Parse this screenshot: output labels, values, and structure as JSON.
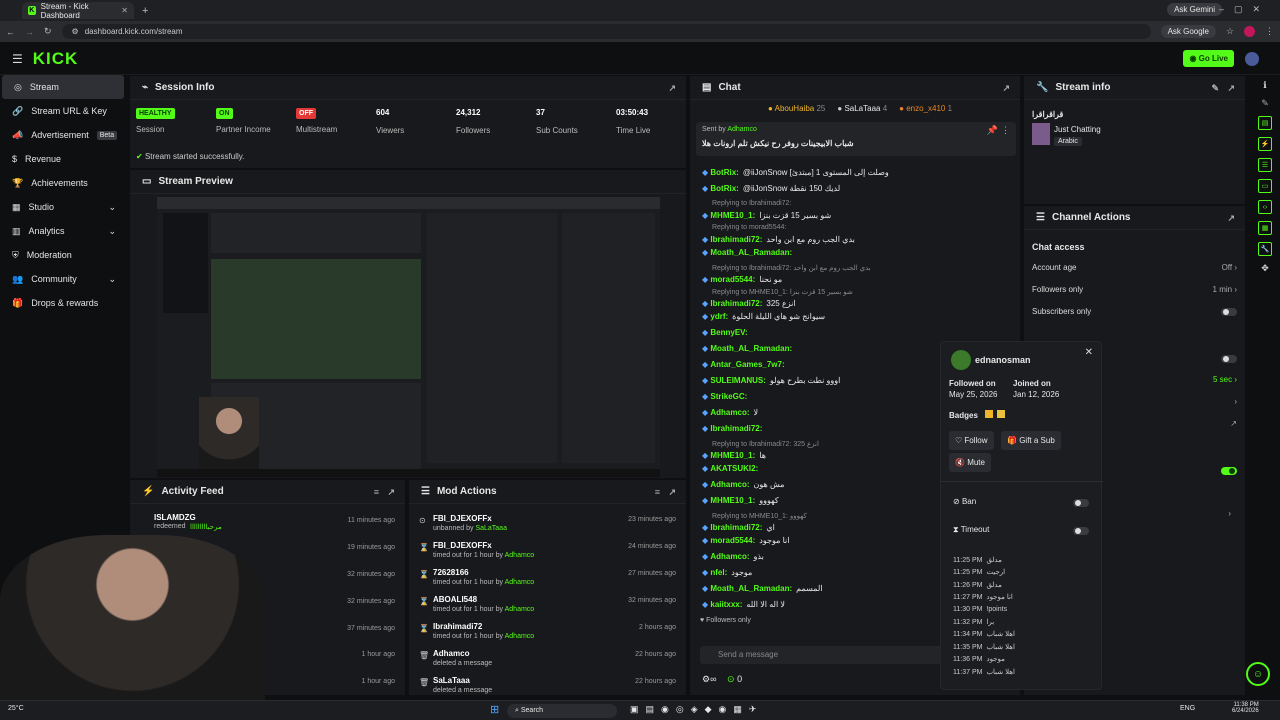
{
  "browser": {
    "tab_title": "Stream - Kick Dashboard",
    "url": "dashboard.kick.com/stream",
    "ask_gemini": "Ask Gemini",
    "ask_google": "Ask Google"
  },
  "app": {
    "logo": "KICK",
    "go_live": "Go Live"
  },
  "sidebar": {
    "items": [
      {
        "label": "Stream"
      },
      {
        "label": "Stream URL & Key"
      },
      {
        "label": "Advertisement",
        "badge": "Beta"
      },
      {
        "label": "Revenue"
      },
      {
        "label": "Achievements"
      },
      {
        "label": "Studio"
      },
      {
        "label": "Analytics"
      },
      {
        "label": "Moderation"
      },
      {
        "label": "Community"
      },
      {
        "label": "Drops & rewards"
      }
    ]
  },
  "session": {
    "title": "Session Info",
    "status_msg": "Stream started successfully.",
    "badges": [
      {
        "text": "HEALTHY",
        "label": "Session"
      },
      {
        "text": "ON",
        "label": "Partner Income"
      },
      {
        "text": "OFF",
        "label": "Multistream"
      }
    ],
    "stats": [
      {
        "value": "604",
        "label": "Viewers"
      },
      {
        "value": "24,312",
        "label": "Followers"
      },
      {
        "value": "37",
        "label": "Sub Counts"
      },
      {
        "value": "03:50:43",
        "label": "Time Live"
      }
    ]
  },
  "preview": {
    "title": "Stream Preview"
  },
  "activity": {
    "title": "Activity Feed",
    "rows": [
      {
        "name": "ISLAMDZG",
        "action": "redeemed",
        "extra": "مرحبااااااااا",
        "time": "11 minutes ago"
      },
      {
        "time": "19 minutes ago"
      },
      {
        "time": "32 minutes ago"
      },
      {
        "time": "32 minutes ago"
      },
      {
        "time": "37 minutes ago"
      },
      {
        "time": "1 hour ago"
      },
      {
        "time": "1 hour ago"
      }
    ]
  },
  "mod": {
    "title": "Mod Actions",
    "rows": [
      {
        "name": "FBI_DJEXOFFx",
        "desc": "unbanned by",
        "by": "SaLaTaaa",
        "time": "23 minutes ago"
      },
      {
        "name": "FBI_DJEXOFFx",
        "desc": "timed out for 1 hour by",
        "by": "Adhamco",
        "time": "24 minutes ago"
      },
      {
        "name": "72628166",
        "desc": "timed out for 1 hour by",
        "by": "Adhamco",
        "time": "27 minutes ago"
      },
      {
        "name": "ABOALI548",
        "desc": "timed out for 1 hour by",
        "by": "Adhamco",
        "time": "32 minutes ago"
      },
      {
        "name": "Ibrahimadi72",
        "desc": "timed out for 1 hour by",
        "by": "Adhamco",
        "time": "2 hours ago"
      },
      {
        "name": "Adhamco",
        "desc": "deleted a message",
        "by": "",
        "time": "22 hours ago"
      },
      {
        "name": "SaLaTaaa",
        "desc": "deleted a message",
        "by": "",
        "time": "22 hours ago"
      }
    ]
  },
  "chat": {
    "title": "Chat",
    "top": [
      {
        "name": "AbouHaiba",
        "n": "25"
      },
      {
        "name": "SaLaTaaa",
        "n": "4"
      },
      {
        "name": "enzo_x410",
        "n": "1"
      }
    ],
    "pinned_by": "Sent by",
    "pinned_user": "Adhamco",
    "pinned_text": "شباب الابيجينات روفر رح نيكش تلم ارونات هلا",
    "lines": [
      {
        "name": "BotRix:",
        "text": "@iiJonSnow وصلت إلى المستوى 1 [مبتدئ]"
      },
      {
        "name": "BotRix:",
        "text": "@iiJonSnow لديك 150 نقطة"
      },
      {
        "reply": "Replying to Ibrahimadi72:",
        "name": "MHME10_1:",
        "text": "شو بسير 15 قزت بنزا"
      },
      {
        "reply": "Replying to morad5544:",
        "name": "Ibrahimadi72:",
        "text": "بدي الجب روم مع ابن واحد"
      },
      {
        "name": "Moath_AL_Ramadan:",
        "text": ""
      },
      {
        "reply": "Replying to Ibrahimadi72: بدي الجب روم مع ابن واحد",
        "name": "morad5544:",
        "text": "مو نحنا"
      },
      {
        "reply": "Replying to MHME10_1: شو بسير 15 قزت بنزا",
        "name": "Ibrahimadi72:",
        "text": "انزع 325"
      },
      {
        "name": "ydrf:",
        "text": "سيوانج شو هاي الليلة الحلوة"
      },
      {
        "name": "BennyEV:",
        "text": ""
      },
      {
        "name": "Moath_AL_Ramadan:",
        "text": ""
      },
      {
        "name": "Antar_Games_7w7:",
        "text": ""
      },
      {
        "name": "SULEIMANUS:",
        "text": "اووو نطت بطرح هولو"
      },
      {
        "name": "StrikeGC:",
        "text": ""
      },
      {
        "name": "Adhamco:",
        "text": "لا"
      },
      {
        "name": "Ibrahimadi72:",
        "text": ""
      },
      {
        "reply": "Replying to Ibrahimadi72: انزع 325",
        "name": "MHME10_1:",
        "text": "ها"
      },
      {
        "name": "AKATSUKI2:",
        "text": ""
      },
      {
        "name": "Adhamco:",
        "text": "مش هون"
      },
      {
        "name": "MHME10_1:",
        "text": "كهووو"
      },
      {
        "reply": "Replying to MHME10_1: كهووو",
        "name": "Ibrahimadi72:",
        "text": "اي"
      },
      {
        "name": "morad5544:",
        "text": "انا موجود"
      },
      {
        "name": "Adhamco:",
        "text": "بذو"
      },
      {
        "name": "nfel:",
        "text": "موجود"
      },
      {
        "name": "Moath_AL_Ramadan:",
        "text": "المسمم"
      },
      {
        "name": "kaiitxxx:",
        "text": "لا اله الا الله"
      }
    ],
    "followers_only": "Followers only",
    "placeholder": "Send a message",
    "count": "0"
  },
  "stream_info": {
    "title": "Stream info",
    "stream_title": "قراقراقرا",
    "category": "Just Chatting",
    "tag": "Arabic"
  },
  "channel_actions": {
    "title": "Channel Actions",
    "section": "Chat access",
    "rows": [
      {
        "label": "Account age",
        "value": "Off"
      },
      {
        "label": "Followers only",
        "value": "1 min"
      },
      {
        "label": "Subscribers only",
        "value": ""
      }
    ],
    "slow_value": "5 sec"
  },
  "user_card": {
    "name": "ednanosman",
    "followed_label": "Followed on",
    "followed": "May 25, 2026",
    "joined_label": "Joined on",
    "joined": "Jan 12, 2026",
    "badges": "Badges",
    "follow": "Follow",
    "gift": "Gift a Sub",
    "mute": "Mute",
    "ban": "Ban",
    "timeout": "Timeout",
    "log": [
      {
        "t": "11:25 PM",
        "m": "مدلق"
      },
      {
        "t": "11:25 PM",
        "m": "ارجيت"
      },
      {
        "t": "11:26 PM",
        "m": "مدلق"
      },
      {
        "t": "11:27 PM",
        "m": "انا موجود"
      },
      {
        "t": "11:30 PM",
        "m": "!points"
      },
      {
        "t": "11:32 PM",
        "m": "برا"
      },
      {
        "t": "11:34 PM",
        "m": "اهلا شباب"
      },
      {
        "t": "11:35 PM",
        "m": "اهلا شباب"
      },
      {
        "t": "11:36 PM",
        "m": "موجود"
      },
      {
        "t": "11:37 PM",
        "m": "اهلا شباب"
      }
    ]
  },
  "taskbar": {
    "search": "Search",
    "weather": "25°C",
    "lang": "ENG",
    "time": "11:38 PM",
    "date": "6/24/2026"
  },
  "colors": {
    "accent": "#53fc18",
    "panel": "#18191c",
    "bg": "#0e0f11"
  }
}
